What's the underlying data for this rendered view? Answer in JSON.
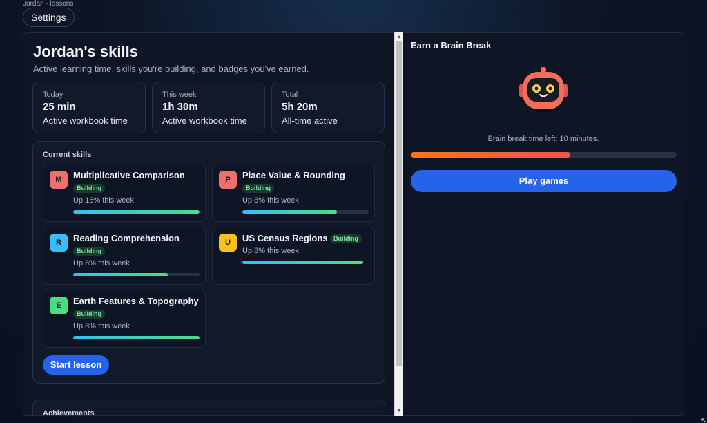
{
  "breadcrumb": "Jordan · lessons",
  "header": {
    "settings_label": "Settings"
  },
  "skills_page": {
    "title": "Jordan's skills",
    "subtitle": "Active learning time, skills you're building, and badges you've earned."
  },
  "stats": [
    {
      "label": "Today",
      "value": "25 min",
      "desc": "Active workbook time"
    },
    {
      "label": "This week",
      "value": "1h 30m",
      "desc": "Active workbook time"
    },
    {
      "label": "Total",
      "value": "5h 20m",
      "desc": "All-time active"
    }
  ],
  "current_skills": {
    "heading": "Current skills",
    "items": [
      {
        "letter": "M",
        "name": "Multiplicative Comparison",
        "badge": "Building",
        "change": "Up 16% this week",
        "progress": 1.0,
        "color": "#f26d6d"
      },
      {
        "letter": "P",
        "name": "Place Value & Rounding",
        "badge": "Building",
        "change": "Up 8% this week",
        "progress": 0.75,
        "color": "#f26d6d"
      },
      {
        "letter": "R",
        "name": "Reading Comprehension",
        "badge": "Building",
        "change": "Up 8% this week",
        "progress": 0.75,
        "color": "#38bdf8"
      },
      {
        "letter": "U",
        "name": "US Census Regions",
        "badge": "Building",
        "change": "Up 8% this week",
        "progress": 1.0,
        "color": "#fbbf24"
      },
      {
        "letter": "E",
        "name": "Earth Features & Topography",
        "badge": "Building",
        "change": "Up 8% this week",
        "progress": 1.0,
        "color": "#4ade80"
      }
    ],
    "start_label": "Start lesson"
  },
  "achievements": {
    "heading": "Achievements"
  },
  "brain_break": {
    "title": "Earn a Brain Break",
    "time_left": "Brain break time left: 10 minutes.",
    "progress": 0.6,
    "play_label": "Play games"
  }
}
